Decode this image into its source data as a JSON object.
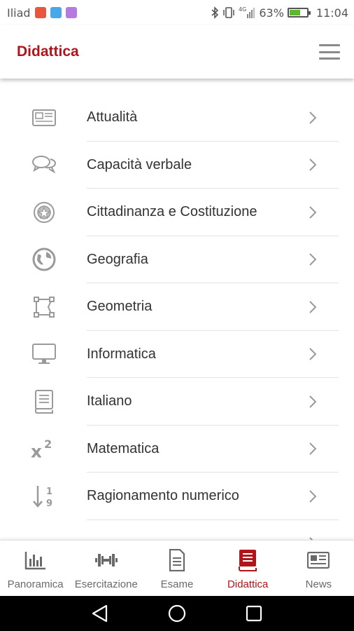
{
  "status_bar": {
    "carrier": "Iliad",
    "battery_percent": "63%",
    "battery_level": 0.63,
    "time": "11:04",
    "network": "4G"
  },
  "header": {
    "title": "Didattica",
    "menu_icon": "hamburger-menu-icon",
    "accent_color": "#b0151b"
  },
  "topics": [
    {
      "label": "Attualità",
      "icon": "newspaper-icon"
    },
    {
      "label": "Capacità verbale",
      "icon": "chat-bubbles-icon"
    },
    {
      "label": "Cittadinanza e Costituzione",
      "icon": "emblem-icon"
    },
    {
      "label": "Geografia",
      "icon": "globe-icon"
    },
    {
      "label": "Geometria",
      "icon": "geometry-shape-icon"
    },
    {
      "label": "Informatica",
      "icon": "monitor-icon"
    },
    {
      "label": "Italiano",
      "icon": "book-icon"
    },
    {
      "label": "Matematica",
      "icon": "x-squared-icon"
    },
    {
      "label": "Ragionamento numerico",
      "icon": "sort-numeric-icon"
    },
    {
      "label": "",
      "icon": "pi-icon"
    }
  ],
  "bottom_nav": {
    "active": "Didattica",
    "items": [
      {
        "label": "Panoramica",
        "icon": "bar-chart-icon"
      },
      {
        "label": "Esercitazione",
        "icon": "dumbbell-icon"
      },
      {
        "label": "Esame",
        "icon": "document-icon"
      },
      {
        "label": "Didattica",
        "icon": "book-icon"
      },
      {
        "label": "News",
        "icon": "newspaper-icon"
      }
    ]
  },
  "system_nav": [
    "back-icon",
    "home-icon",
    "recents-icon"
  ]
}
